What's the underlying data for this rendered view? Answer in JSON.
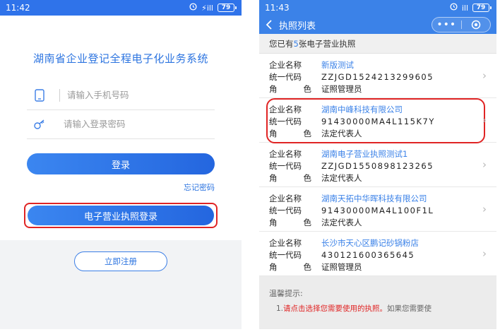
{
  "left": {
    "status": {
      "time": "11:42",
      "signal": "⚡ill",
      "battery": "79"
    },
    "app_title": "湖南省企业登记全程电子化业务系统",
    "phone_placeholder": "请输入手机号码",
    "password_placeholder": "请输入登录密码",
    "login_label": "登录",
    "forgot_label": "忘记密码",
    "elicense_label": "电子营业执照登录",
    "register_label": "立即注册"
  },
  "right": {
    "status": {
      "time": "11:43",
      "signal": "ill",
      "battery": "79"
    },
    "nav_title": "执照列表",
    "capsule_more": "•••",
    "count_prefix": "您已有",
    "count_num": "5",
    "count_suffix": "张电子营业执照",
    "labels": {
      "name": "企业名称",
      "code": "统一代码",
      "role_a": "角",
      "role_b": "色"
    },
    "licenses": [
      {
        "name": "新版测试",
        "code": "ZZJGD1524213299605",
        "role": "证照管理员"
      },
      {
        "name": "湖南中峰科技有限公司",
        "code": "91430000MA4L115K7Y",
        "role": "法定代表人"
      },
      {
        "name": "湖南电子营业执照测试1",
        "code": "ZZJGD1550898123265",
        "role": "法定代表人"
      },
      {
        "name": "湖南天拓中华晖科技有限公司",
        "code": "91430000MA4L100F1L",
        "role": "法定代表人"
      },
      {
        "name": "长沙市天心区鹏记砂锅粉店",
        "code": "430121600365645",
        "role": "证照管理员"
      }
    ],
    "tips_title": "温馨提示:",
    "tips_line_num": "1.",
    "tips_line_red": "请点击选择您需要使用的执照。",
    "tips_line_rest": "如果您需要使"
  },
  "colors": {
    "primary": "#2f73ea",
    "accent_red": "#e02424",
    "link_blue": "#2c74e0"
  }
}
